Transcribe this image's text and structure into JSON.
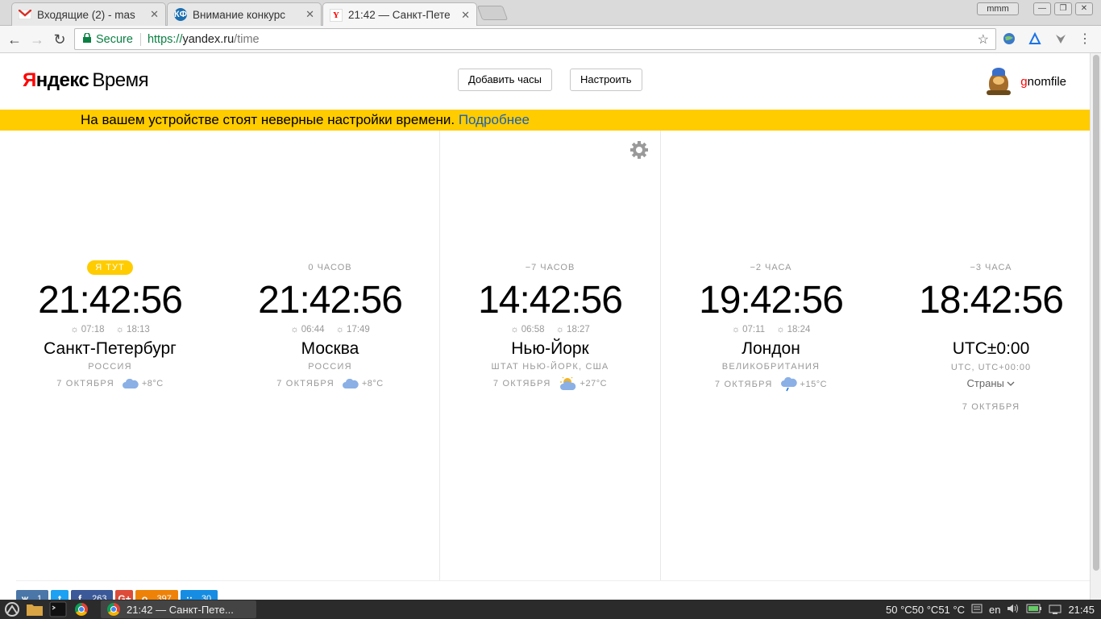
{
  "browser": {
    "tabs": [
      {
        "title": "Входящие (2) - mas",
        "favicon": "gmail-icon"
      },
      {
        "title": "Внимание конкурс",
        "favicon": "kf-icon"
      },
      {
        "title": "21:42 — Санкт-Пете",
        "favicon": "yandex-icon"
      }
    ],
    "profile": "mmm",
    "omnibox": {
      "secure_label": "Secure",
      "scheme": "https://",
      "host": "yandex.ru",
      "path": "/time"
    }
  },
  "header": {
    "logo_brand": "Яндекс",
    "logo_product": "Время",
    "add_clock_label": "Добавить часы",
    "settings_label": "Настроить",
    "username_first": "g",
    "username_rest": "nomfile"
  },
  "warning": {
    "text": "На вашем устройстве стоят неверные настройки времени.",
    "link": "Подробнее"
  },
  "clocks": [
    {
      "offset": "Я ТУТ",
      "time": "21:42:56",
      "sunrise": "07:18",
      "sunset": "18:13",
      "city": "Санкт-Петербург",
      "country": "РОССИЯ",
      "date": "7 ОКТЯБРЯ",
      "weather_icon": "cloud-icon",
      "temp": "+8°C"
    },
    {
      "offset": "0 ЧАСОВ",
      "time": "21:42:56",
      "sunrise": "06:44",
      "sunset": "17:49",
      "city": "Москва",
      "country": "РОССИЯ",
      "date": "7 ОКТЯБРЯ",
      "weather_icon": "cloud-icon",
      "temp": "+8°C"
    },
    {
      "offset": "−7 ЧАСОВ",
      "time": "14:42:56",
      "sunrise": "06:58",
      "sunset": "18:27",
      "city": "Нью-Йорк",
      "country": "ШТАТ НЬЮ-ЙОРК, США",
      "date": "7 ОКТЯБРЯ",
      "weather_icon": "partly-sunny-icon",
      "temp": "+27°C"
    },
    {
      "offset": "−2 ЧАСА",
      "time": "19:42:56",
      "sunrise": "07:11",
      "sunset": "18:24",
      "city": "Лондон",
      "country": "ВЕЛИКОБРИТАНИЯ",
      "date": "7 ОКТЯБРЯ",
      "weather_icon": "rain-cloud-icon",
      "temp": "+15°C"
    }
  ],
  "utc_clock": {
    "offset": "−3 ЧАСА",
    "time": "18:42:56",
    "title": "UTC±0:00",
    "sub": "UTC, UTC+00:00",
    "countries": "Страны",
    "date": "7 ОКТЯБРЯ"
  },
  "share": [
    {
      "icon": "vk-icon",
      "glyph": "ж",
      "count": "1",
      "color": "#4a76a8"
    },
    {
      "icon": "twitter-icon",
      "glyph": "t",
      "count": "",
      "color": "#1da1f2"
    },
    {
      "icon": "facebook-icon",
      "glyph": "f",
      "count": "263",
      "color": "#3b5998"
    },
    {
      "icon": "gplus-icon",
      "glyph": "G+",
      "count": "",
      "color": "#dd4b39"
    },
    {
      "icon": "odnoklassniki-icon",
      "glyph": "о",
      "count": "397",
      "color": "#ee8208"
    },
    {
      "icon": "moimir-icon",
      "glyph": "::",
      "count": "30",
      "color": "#168de2"
    }
  ],
  "taskbar": {
    "task_title": "21:42 — Санкт-Пете...",
    "temps": "50 °C50 °C51 °C",
    "lang": "en",
    "clock": "21:45"
  },
  "colors": {
    "accent_yellow": "#ffcc00",
    "link_blue": "#1a5fb4",
    "yandex_red": "#ff0000"
  }
}
